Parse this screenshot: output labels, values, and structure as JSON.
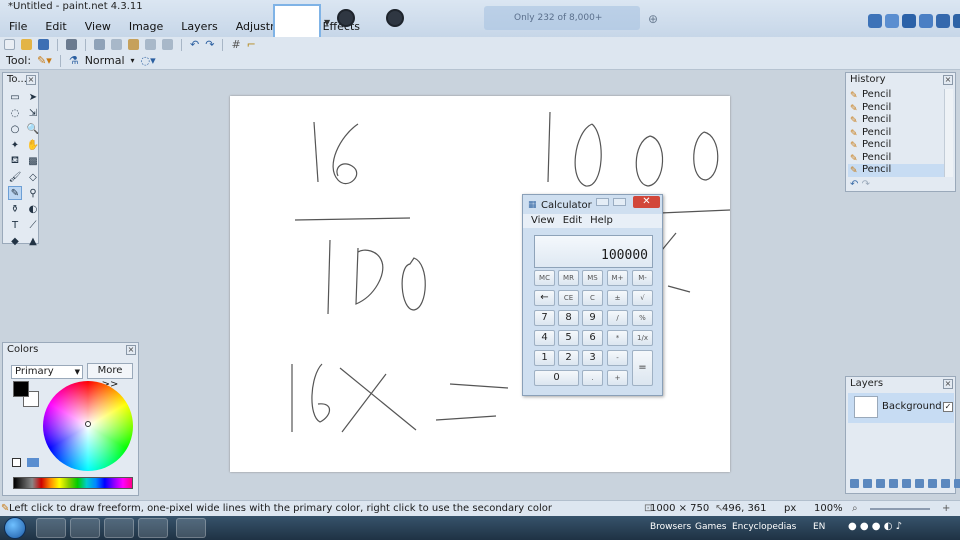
{
  "window": {
    "title": "*Untitled - paint.net 4.3.11"
  },
  "menu": [
    "File",
    "Edit",
    "View",
    "Image",
    "Layers",
    "Adjustments",
    "Effects"
  ],
  "browser_tab": {
    "label": "Only 232 of 8,000+ games..."
  },
  "toolbar": {
    "tool_label": "Tool:",
    "blend_mode": "Normal"
  },
  "tools_panel": {
    "title": "To..."
  },
  "colors_panel": {
    "title": "Colors",
    "select_value": "Primary",
    "more_label": "More >>"
  },
  "history_panel": {
    "title": "History",
    "items": [
      "Pencil",
      "Pencil",
      "Pencil",
      "Pencil",
      "Pencil",
      "Pencil",
      "Pencil"
    ]
  },
  "layers_panel": {
    "title": "Layers",
    "layer_name": "Background"
  },
  "calculator": {
    "title": "Calculator",
    "menu": [
      "View",
      "Edit",
      "Help"
    ],
    "display": "100000",
    "buttons": [
      [
        "MC",
        "MR",
        "MS",
        "M+",
        "M-"
      ],
      [
        "←",
        "CE",
        "C",
        "±",
        "√"
      ],
      [
        "7",
        "8",
        "9",
        "/",
        "%"
      ],
      [
        "4",
        "5",
        "6",
        "*",
        "1/x"
      ],
      [
        "1",
        "2",
        "3",
        "-",
        "="
      ],
      [
        "0",
        ".",
        "+"
      ]
    ]
  },
  "status": {
    "hint": "Left click to draw freeform, one-pixel wide lines with the primary color, right click to use the secondary color",
    "image_size": "1000 × 750",
    "cursor_pos": "496, 361",
    "unit": "px",
    "zoom": "100%"
  },
  "taskbar": {
    "links": [
      "Browsers",
      "Games",
      "Encyclopedias"
    ],
    "lang": "EN"
  }
}
